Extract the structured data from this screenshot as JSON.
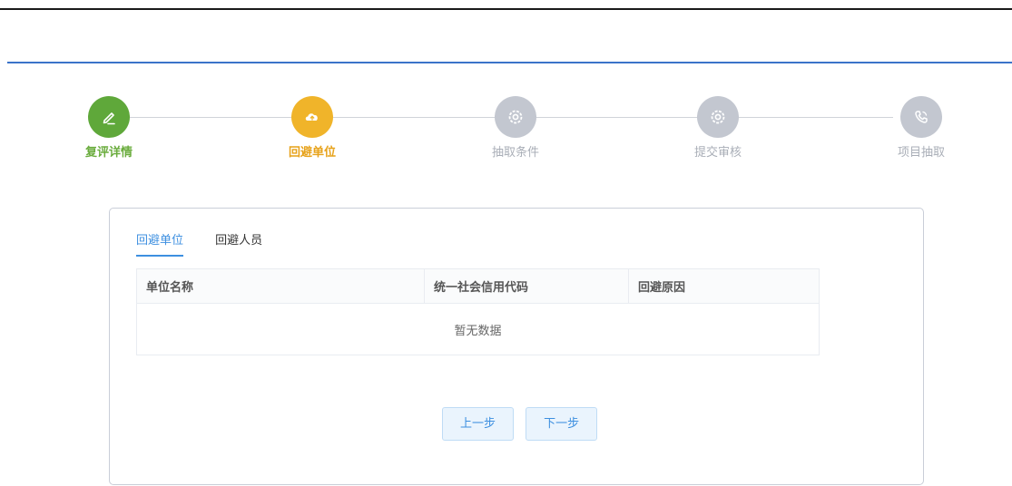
{
  "steps": [
    {
      "label": "复评详情",
      "status": "done",
      "icon": "pencil-icon",
      "color": "#5fa83a"
    },
    {
      "label": "回避单位",
      "status": "active",
      "icon": "cloud-upload-icon",
      "color": "#f0b42a"
    },
    {
      "label": "抽取条件",
      "status": "pending",
      "icon": "gear-icon",
      "color": "#c3c7d0"
    },
    {
      "label": "提交审核",
      "status": "pending",
      "icon": "gear-icon",
      "color": "#c3c7d0"
    },
    {
      "label": "项目抽取",
      "status": "pending",
      "icon": "phone-icon",
      "color": "#c3c7d0"
    }
  ],
  "tabs": [
    {
      "label": "回避单位",
      "active": true
    },
    {
      "label": "回避人员",
      "active": false
    }
  ],
  "table": {
    "columns": [
      "单位名称",
      "统一社会信用代码",
      "回避原因"
    ],
    "empty_text": "暂无数据"
  },
  "buttons": {
    "prev": "上一步",
    "next": "下一步"
  },
  "colors": {
    "accent_blue": "#3d8fe0",
    "header_line": "#3b73c9"
  }
}
